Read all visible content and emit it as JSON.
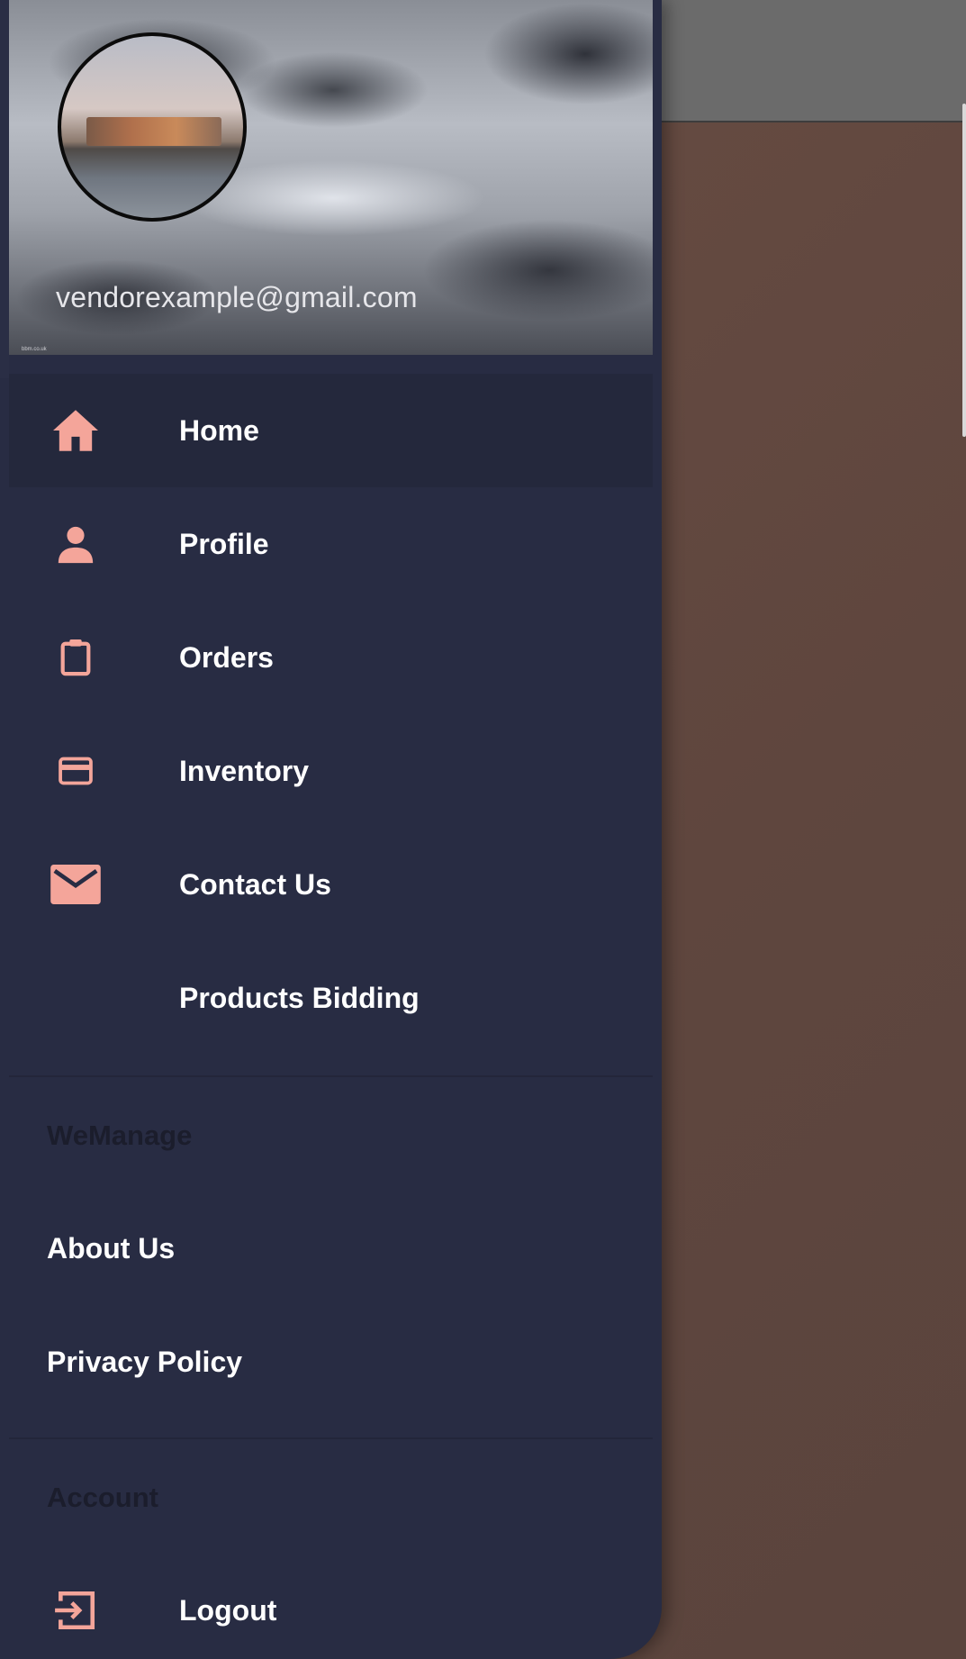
{
  "header": {
    "email": "vendorexample@gmail.com",
    "credit": "bbm.co.uk"
  },
  "nav": {
    "items": [
      {
        "label": "Home",
        "icon": "home-icon"
      },
      {
        "label": "Profile",
        "icon": "person-icon"
      },
      {
        "label": "Orders",
        "icon": "clipboard-icon"
      },
      {
        "label": "Inventory",
        "icon": "card-icon"
      },
      {
        "label": "Contact Us",
        "icon": "mail-icon"
      },
      {
        "label": "Products Bidding",
        "icon": ""
      }
    ]
  },
  "sections": {
    "wemanage": {
      "title": "WeManage",
      "items": [
        "About Us",
        "Privacy Policy"
      ]
    },
    "account": {
      "title": "Account",
      "logout_label": "Logout",
      "logout_icon": "logout-icon"
    }
  },
  "colors": {
    "drawer_bg": "#282c43",
    "active_bg": "#24283c",
    "icon_accent": "#f4a59a",
    "text": "#ffffff",
    "section_title": "#1b1d2c"
  }
}
